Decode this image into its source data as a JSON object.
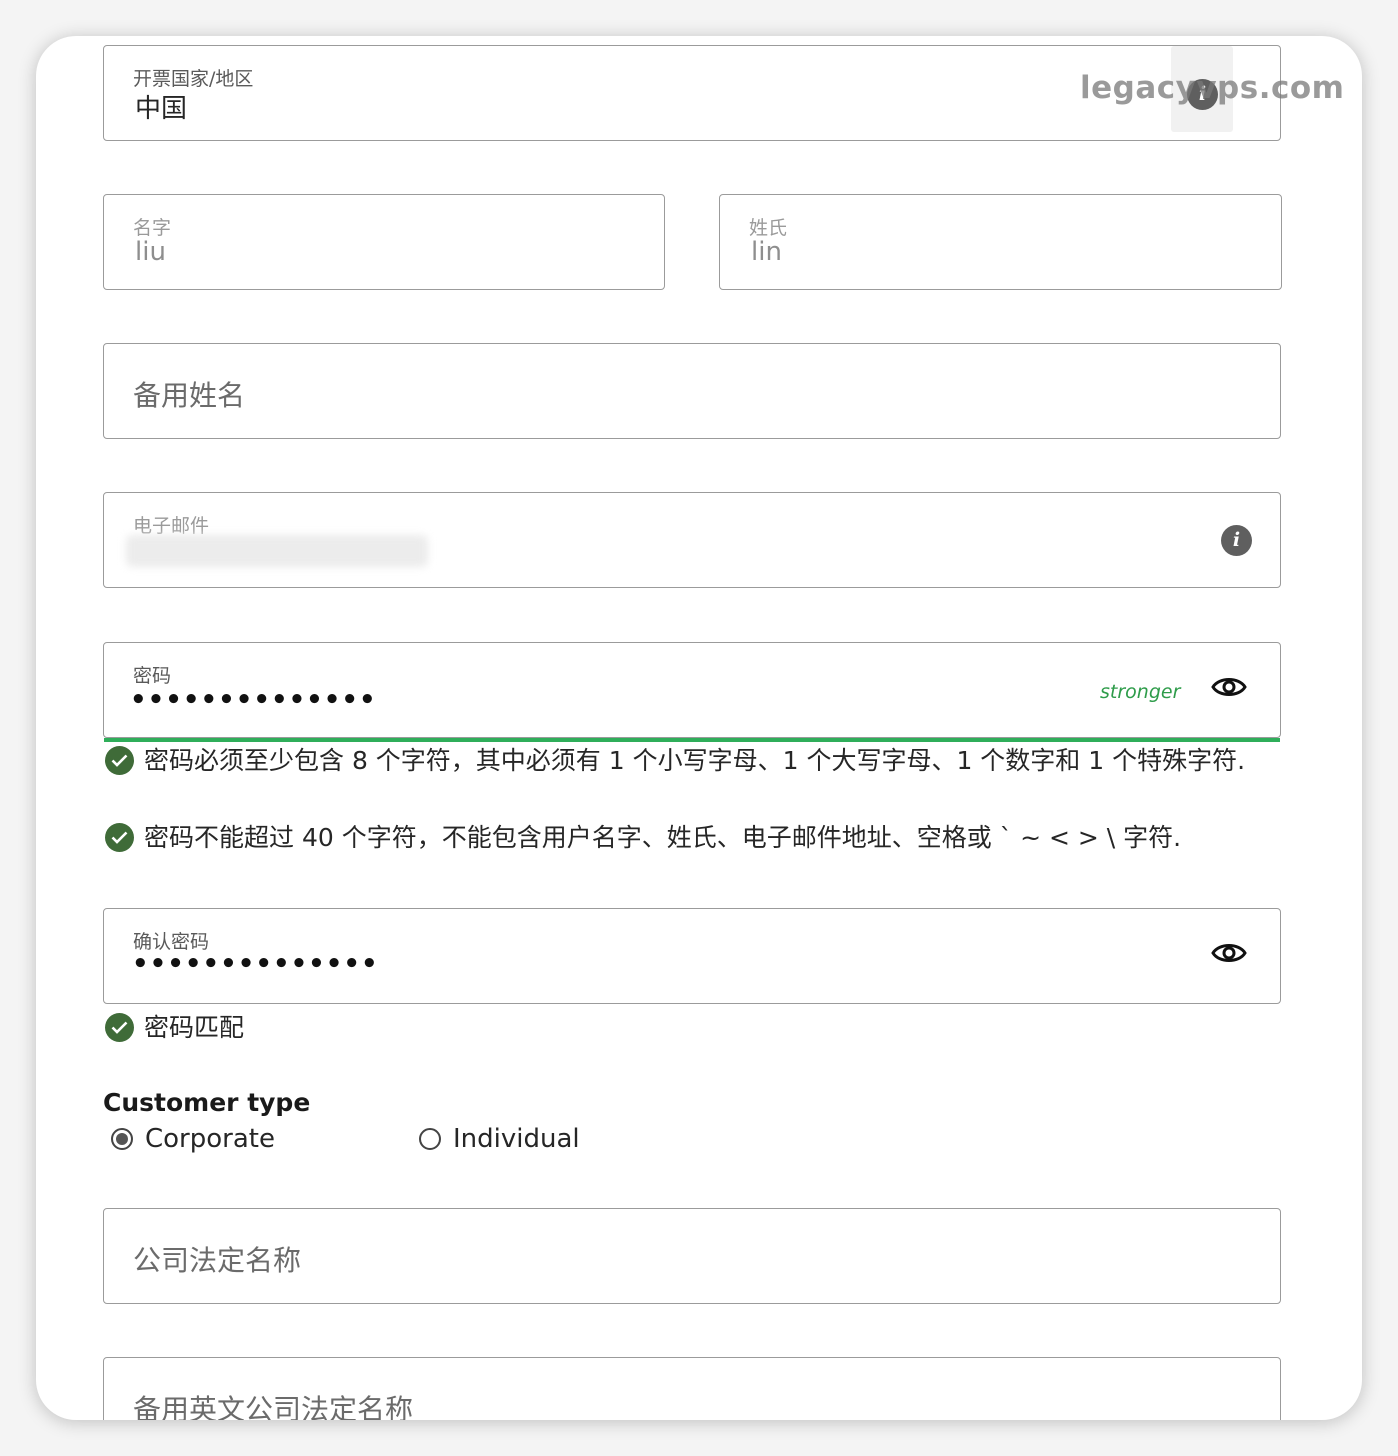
{
  "watermark": "legacyvps.com",
  "billing_country": {
    "label": "开票国家/地区",
    "value": "中国"
  },
  "first_name": {
    "label": "名字",
    "value": "liu"
  },
  "last_name": {
    "label": "姓氏",
    "value": "lin"
  },
  "alternate_name": {
    "placeholder": "备用姓名"
  },
  "email": {
    "label": "电子邮件"
  },
  "password": {
    "label": "密码",
    "masked_value": "••••••••••••••",
    "strength": "stronger",
    "strength_color": "#2e9c4a"
  },
  "password_rules": [
    "密码必须至少包含 8 个字符，其中必须有 1 个小写字母、1 个大写字母、1 个数字和 1 个特殊字符.",
    "密码不能超过 40 个字符，不能包含用户名字、姓氏、电子邮件地址、空格或 ` ~ < > \\ 字符."
  ],
  "confirm_password": {
    "label": "确认密码",
    "masked_value": "••••••••••••••",
    "match_message": "密码匹配"
  },
  "customer_type": {
    "title": "Customer type",
    "options": [
      {
        "label": "Corporate",
        "selected": true
      },
      {
        "label": "Individual",
        "selected": false
      }
    ]
  },
  "company_legal_name": {
    "placeholder": "公司法定名称"
  },
  "alt_english_company_name": {
    "placeholder": "备用英文公司法定名称"
  },
  "colors": {
    "check": "#3f6b38",
    "strength_bar": "#2fae5a",
    "border": "#9b9b9b"
  }
}
